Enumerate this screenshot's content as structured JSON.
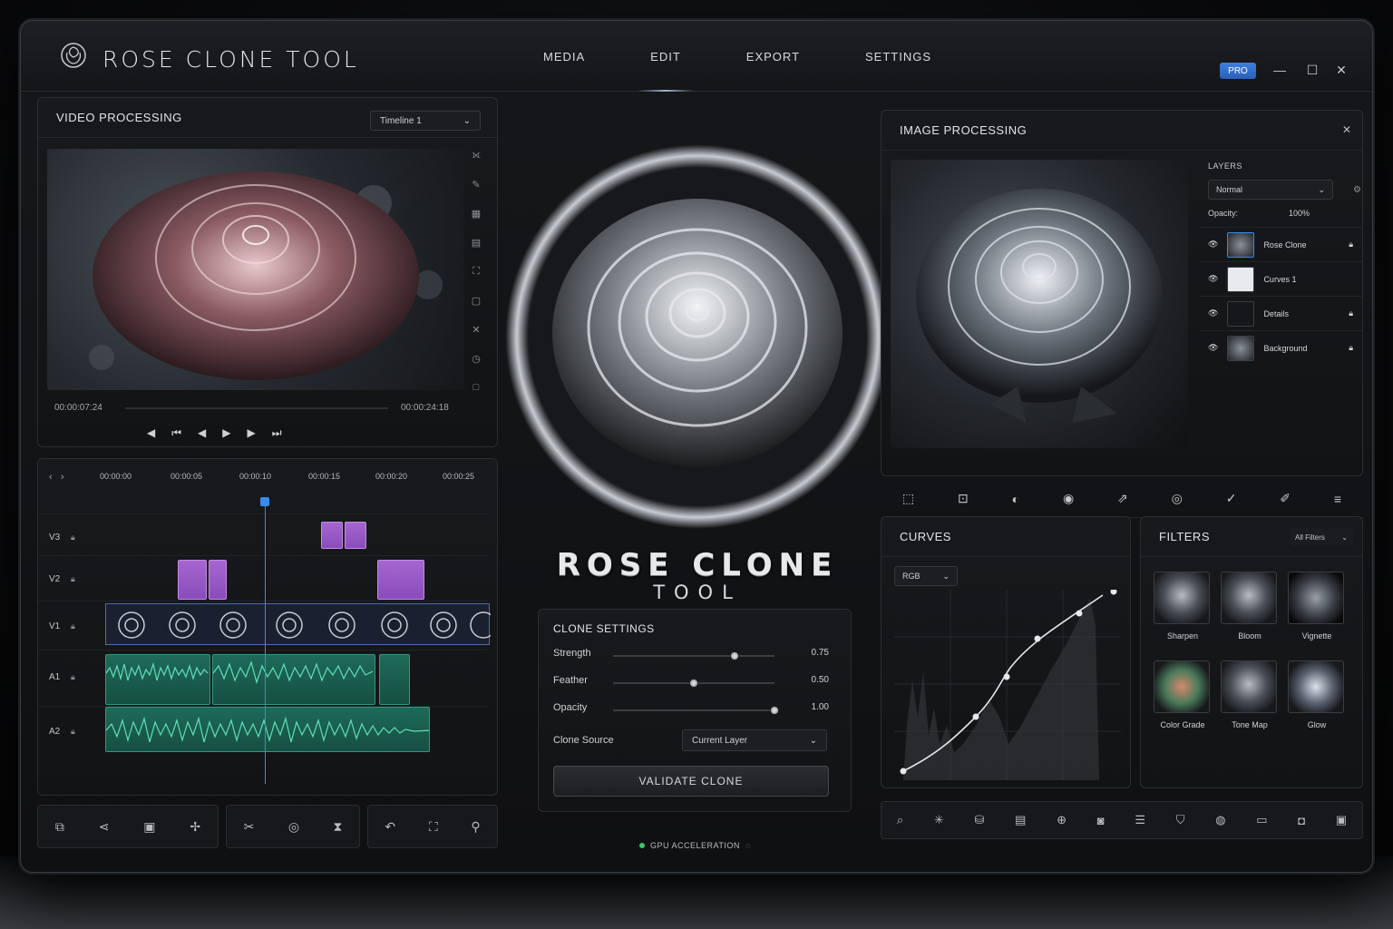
{
  "app": {
    "title": "ROSE CLONE TOOL",
    "badge": "PRO"
  },
  "nav": [
    {
      "label": "MEDIA"
    },
    {
      "label": "EDIT",
      "active": true
    },
    {
      "label": "EXPORT"
    },
    {
      "label": "SETTINGS"
    }
  ],
  "window_controls": {
    "minimize": "—",
    "maximize": "☐",
    "close": "✕"
  },
  "video_processing": {
    "title": "VIDEO PROCESSING",
    "timeline_select": "Timeline 1",
    "time_current": "00:00:07:24",
    "time_total": "00:00:24:18"
  },
  "timeline": {
    "ticks": [
      "00:00:00",
      "00:00:05",
      "00:00:10",
      "00:00:15",
      "00:00:20",
      "00:00:25"
    ],
    "tracks": [
      "V3",
      "V2",
      "V1",
      "A1",
      "A2"
    ]
  },
  "center": {
    "brand_main": "ROSE CLONE",
    "brand_sub": "TOOL",
    "clone_settings": {
      "title": "CLONE SETTINGS",
      "strength_label": "Strength",
      "strength_value": "0.75",
      "strength": 0.75,
      "feather_label": "Feather",
      "feather_value": "0.50",
      "feather": 0.5,
      "opacity_label": "Opacity",
      "opacity_value": "1.00",
      "opacity": 1.0,
      "source_label": "Clone Source",
      "source_value": "Current Layer",
      "validate_label": "VALIDATE CLONE"
    },
    "gpu_label": "GPU ACCELERATION"
  },
  "image_processing": {
    "title": "IMAGE PROCESSING",
    "layers_title": "LAYERS",
    "blend_mode": "Normal",
    "opacity_label": "Opacity:",
    "opacity_value": "100%",
    "layers": [
      {
        "name": "Rose Clone"
      },
      {
        "name": "Curves 1"
      },
      {
        "name": "Details"
      },
      {
        "name": "Background"
      }
    ]
  },
  "curves": {
    "title": "CURVES",
    "channel": "RGB"
  },
  "filters": {
    "title": "FILTERS",
    "dropdown": "All Filters",
    "items": [
      "Sharpen",
      "Bloom",
      "Vignette",
      "Color Grade",
      "Tone Map",
      "Glow"
    ]
  },
  "colors": {
    "accent": "#3a8be8",
    "clip_purple": "#9a5ac8",
    "audio_green": "#2e9a80",
    "gpu_ok": "#3fc46a"
  }
}
